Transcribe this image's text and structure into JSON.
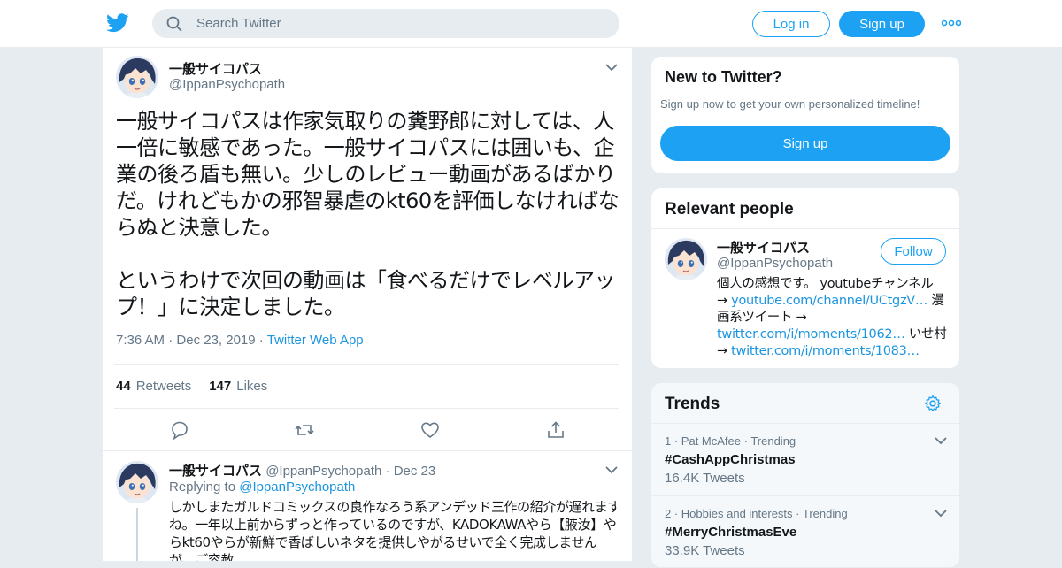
{
  "header": {
    "search_placeholder": "Search Twitter",
    "login_label": "Log in",
    "signup_label": "Sign up"
  },
  "tweet": {
    "name": "一般サイコパス",
    "handle": "@IppanPsychopath",
    "text": "一般サイコパスは作家気取りの糞野郎に対しては、人一倍に敏感であった。一般サイコパスには囲いも、企業の後ろ盾も無い。少しのレビュー動画があるばかりだ。けれどもかの邪智暴虐のkt60を評価しなければならぬと決意した。\n\nというわけで次回の動画は「食べるだけでレベルアップ！」に決定しました。",
    "time": "7:36 AM",
    "date": "Dec 23, 2019",
    "source": "Twitter Web App",
    "retweets_count": "44",
    "retweets_label": "Retweets",
    "likes_count": "147",
    "likes_label": "Likes"
  },
  "reply": {
    "name": "一般サイコパス",
    "handle": "@IppanPsychopath",
    "date": "Dec 23",
    "replying_label": "Replying to",
    "replying_handle": "@IppanPsychopath",
    "text": "しかしまたガルドコミックスの良作なろう系アンデッド三作の紹介が遅れますね。一年以上前からずっと作っているのですが、KADOKAWAやら【腋汝】やらkt60やらが新鮮で香ばしいネタを提供しやがるせいで全く完成しませんが…ご容赦。"
  },
  "new_to_twitter": {
    "title": "New to Twitter?",
    "subtitle": "Sign up now to get your own personalized timeline!",
    "signup_label": "Sign up"
  },
  "relevant_people": {
    "title": "Relevant people",
    "name": "一般サイコパス",
    "handle": "@IppanPsychopath",
    "follow_label": "Follow",
    "bio_1": "個人の感想です。 youtubeチャンネル",
    "bio_arrow": "→ ",
    "bio_link_1": "youtube.com/channel/UCtgzV…",
    "bio_2": " 漫画系ツイート →",
    "bio_link_2": "twitter.com/i/moments/1062…",
    "bio_3": " いせ村",
    "bio_link_3": "twitter.com/i/moments/1083…"
  },
  "trends": {
    "title": "Trends",
    "items": [
      {
        "rank": "1",
        "context": "Pat McAfee",
        "status": "Trending",
        "name": "#CashAppChristmas",
        "count": "16.4K Tweets"
      },
      {
        "rank": "2",
        "context": "Hobbies and interests",
        "status": "Trending",
        "name": "#MerryChristmasEve",
        "count": "33.9K Tweets"
      }
    ]
  },
  "colors": {
    "brand": "#1da1f2",
    "link": "#1b95e0",
    "secondary_text": "#657786",
    "background": "#e6ecf0"
  },
  "icons": [
    "twitter-bird-icon",
    "search-icon",
    "more-dots-icon",
    "chevron-down-icon",
    "reply-icon",
    "retweet-icon",
    "like-icon",
    "share-icon",
    "settings-gear-icon"
  ]
}
